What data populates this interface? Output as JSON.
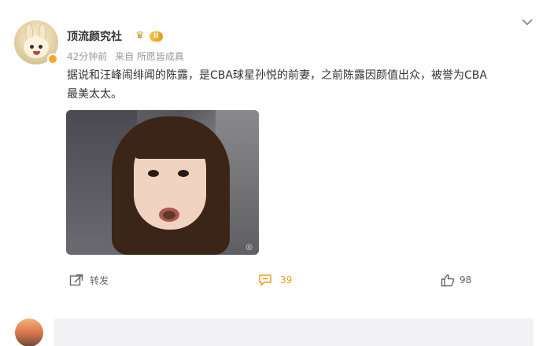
{
  "post": {
    "author": "顶流颜究社",
    "level_label": "II",
    "time": "42分钟前",
    "source": "来自 所愿皆成真",
    "text_line1": "据说和汪峰闹绯闻的陈露，是CBA球星孙悦的前妻，之前陈露因颜值出众，被誉为CBA",
    "text_line2": "最美太太。",
    "image_watermark": "◎",
    "icons": {
      "more": "chevron-down-icon",
      "crown": "crown-icon",
      "repost": "repost-icon",
      "comment": "comment-icon",
      "like": "like-icon"
    }
  },
  "actions": {
    "repost_label": "转发",
    "comment_count": "39",
    "like_count": "98"
  },
  "colors": {
    "accent": "#f29b1a",
    "muted": "#999999",
    "text": "#333333"
  }
}
